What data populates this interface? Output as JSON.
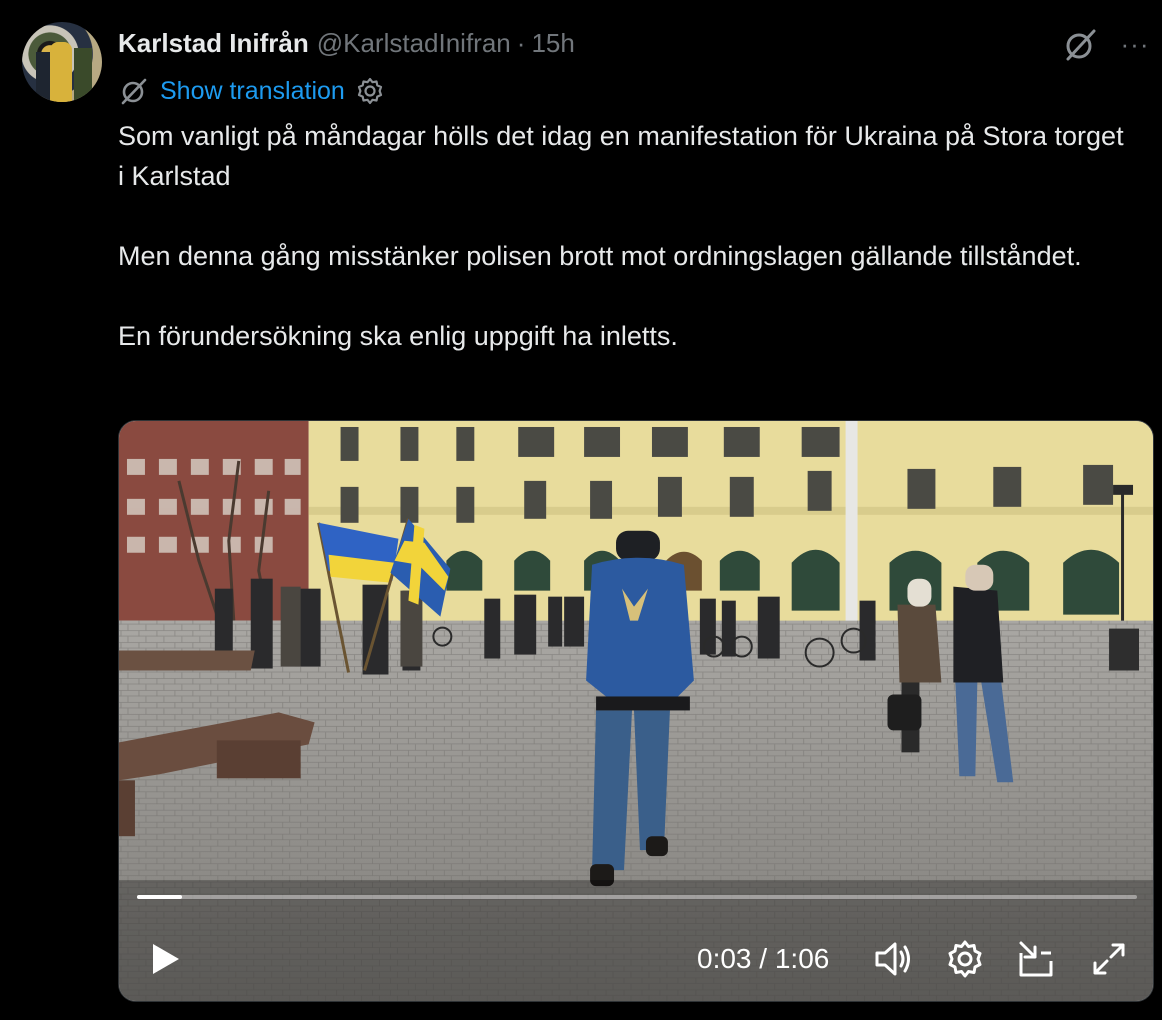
{
  "tweet": {
    "author_name": "Karlstad Inifrån",
    "author_handle": "@KarlstadInifran",
    "separator": "·",
    "time": "15h",
    "more_label": "···",
    "translate_label": "Show translation",
    "paragraphs": [
      "Som vanligt på måndagar hölls det idag en manifestation för Ukraina på Stora torget i Karlstad",
      "Men denna gång misstänker polisen brott mot ordningslagen gällande tillståndet.",
      "En förundersökning ska enlig uppgift ha inletts."
    ]
  },
  "video": {
    "current_time": "0:03",
    "duration": "1:06",
    "time_separator": " / ",
    "progress": 0.045,
    "icons": [
      "play-icon",
      "volume-icon",
      "settings-icon",
      "picture-in-picture-icon",
      "fullscreen-icon"
    ]
  },
  "colors": {
    "background": "#000000",
    "text": "#e7e9ea",
    "secondary": "#71767b",
    "link": "#1d9bf0"
  }
}
